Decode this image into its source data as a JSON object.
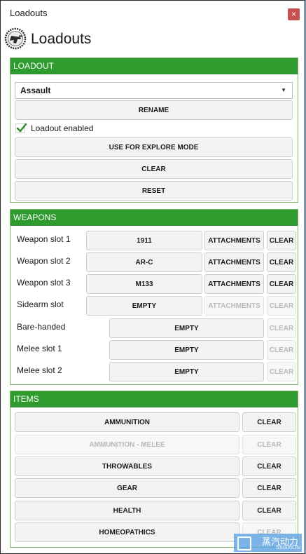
{
  "window": {
    "title": "Loadouts",
    "close_label": "×"
  },
  "header": {
    "title": "Loadouts"
  },
  "loadout": {
    "heading": "LOADOUT",
    "selected": "Assault",
    "rename": "RENAME",
    "enabled_label": "Loadout enabled",
    "enabled": true,
    "explore": "USE FOR EXPLORE MODE",
    "clear": "CLEAR",
    "reset": "RESET"
  },
  "weapons": {
    "heading": "WEAPONS",
    "slots": [
      {
        "label": "Weapon slot 1",
        "value": "1911",
        "attachments": "ATTACHMENTS",
        "clear": "CLEAR"
      },
      {
        "label": "Weapon slot 2",
        "value": "AR-C",
        "attachments": "ATTACHMENTS",
        "clear": "CLEAR"
      },
      {
        "label": "Weapon slot 3",
        "value": "M133",
        "attachments": "ATTACHMENTS",
        "clear": "CLEAR"
      },
      {
        "label": "Sidearm slot",
        "value": "EMPTY",
        "attachments": "ATTACHMENTS",
        "clear": "CLEAR"
      },
      {
        "label": "Bare-handed",
        "value": "EMPTY",
        "clear": "CLEAR"
      },
      {
        "label": "Melee slot 1",
        "value": "EMPTY",
        "clear": "CLEAR"
      },
      {
        "label": "Melee slot 2",
        "value": "EMPTY",
        "clear": "CLEAR"
      }
    ]
  },
  "items": {
    "heading": "ITEMS",
    "rows": [
      {
        "label": "AMMUNITION",
        "clear": "CLEAR"
      },
      {
        "label": "AMMUNITION - MELEE",
        "clear": "CLEAR"
      },
      {
        "label": "THROWABLES",
        "clear": "CLEAR"
      },
      {
        "label": "GEAR",
        "clear": "CLEAR"
      },
      {
        "label": "HEALTH",
        "clear": "CLEAR"
      },
      {
        "label": "HOMEOPATHICS",
        "clear": "CLEAR"
      }
    ]
  },
  "watermark": {
    "text_cn": "蒸汽动力",
    "text_en": "SteamOlv"
  },
  "colors": {
    "accent": "#2f9b2f",
    "close": "#c75050"
  }
}
